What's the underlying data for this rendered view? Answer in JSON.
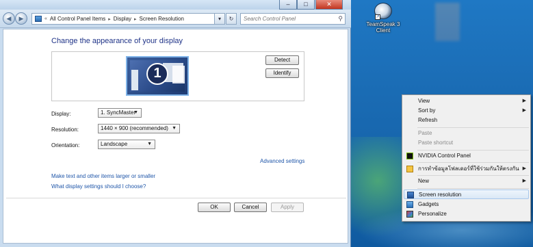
{
  "window": {
    "breadcrumb": [
      "All Control Panel Items",
      "Display",
      "Screen Resolution"
    ],
    "search_placeholder": "Search Control Panel",
    "heading": "Change the appearance of your display",
    "monitor_number": "1",
    "detect_label": "Detect",
    "identify_label": "Identify",
    "display_label": "Display:",
    "display_value": "1. SyncMaster",
    "resolution_label": "Resolution:",
    "resolution_value": "1440 × 900 (recommended)",
    "orientation_label": "Orientation:",
    "orientation_value": "Landscape",
    "advanced_link": "Advanced settings",
    "link_text_size": "Make text and other items larger or smaller",
    "link_help": "What display settings should I choose?",
    "ok_label": "OK",
    "cancel_label": "Cancel",
    "apply_label": "Apply"
  },
  "desktop": {
    "icon_label_1": "TeamSpeak 3",
    "icon_label_2": "Client"
  },
  "context_menu": {
    "view": "View",
    "sort_by": "Sort by",
    "refresh": "Refresh",
    "paste": "Paste",
    "paste_shortcut": "Paste shortcut",
    "nvidia": "NVIDIA Control Panel",
    "thai_item": "การทำข้อมูลโฟลเดอร์ที่ใช้ร่วมกันให้ตรงกัน",
    "new": "New",
    "screen_resolution": "Screen resolution",
    "gadgets": "Gadgets",
    "personalize": "Personalize"
  },
  "icons": {
    "back": "back-arrow-icon",
    "forward": "forward-arrow-icon",
    "dropdown": "chevron-down-icon",
    "refresh": "refresh-icon",
    "search": "search-icon",
    "submenu": "chevron-right-icon"
  },
  "colors": {
    "heading": "#1e3287",
    "link": "#1e55a8",
    "close_button": "#c2351f"
  }
}
